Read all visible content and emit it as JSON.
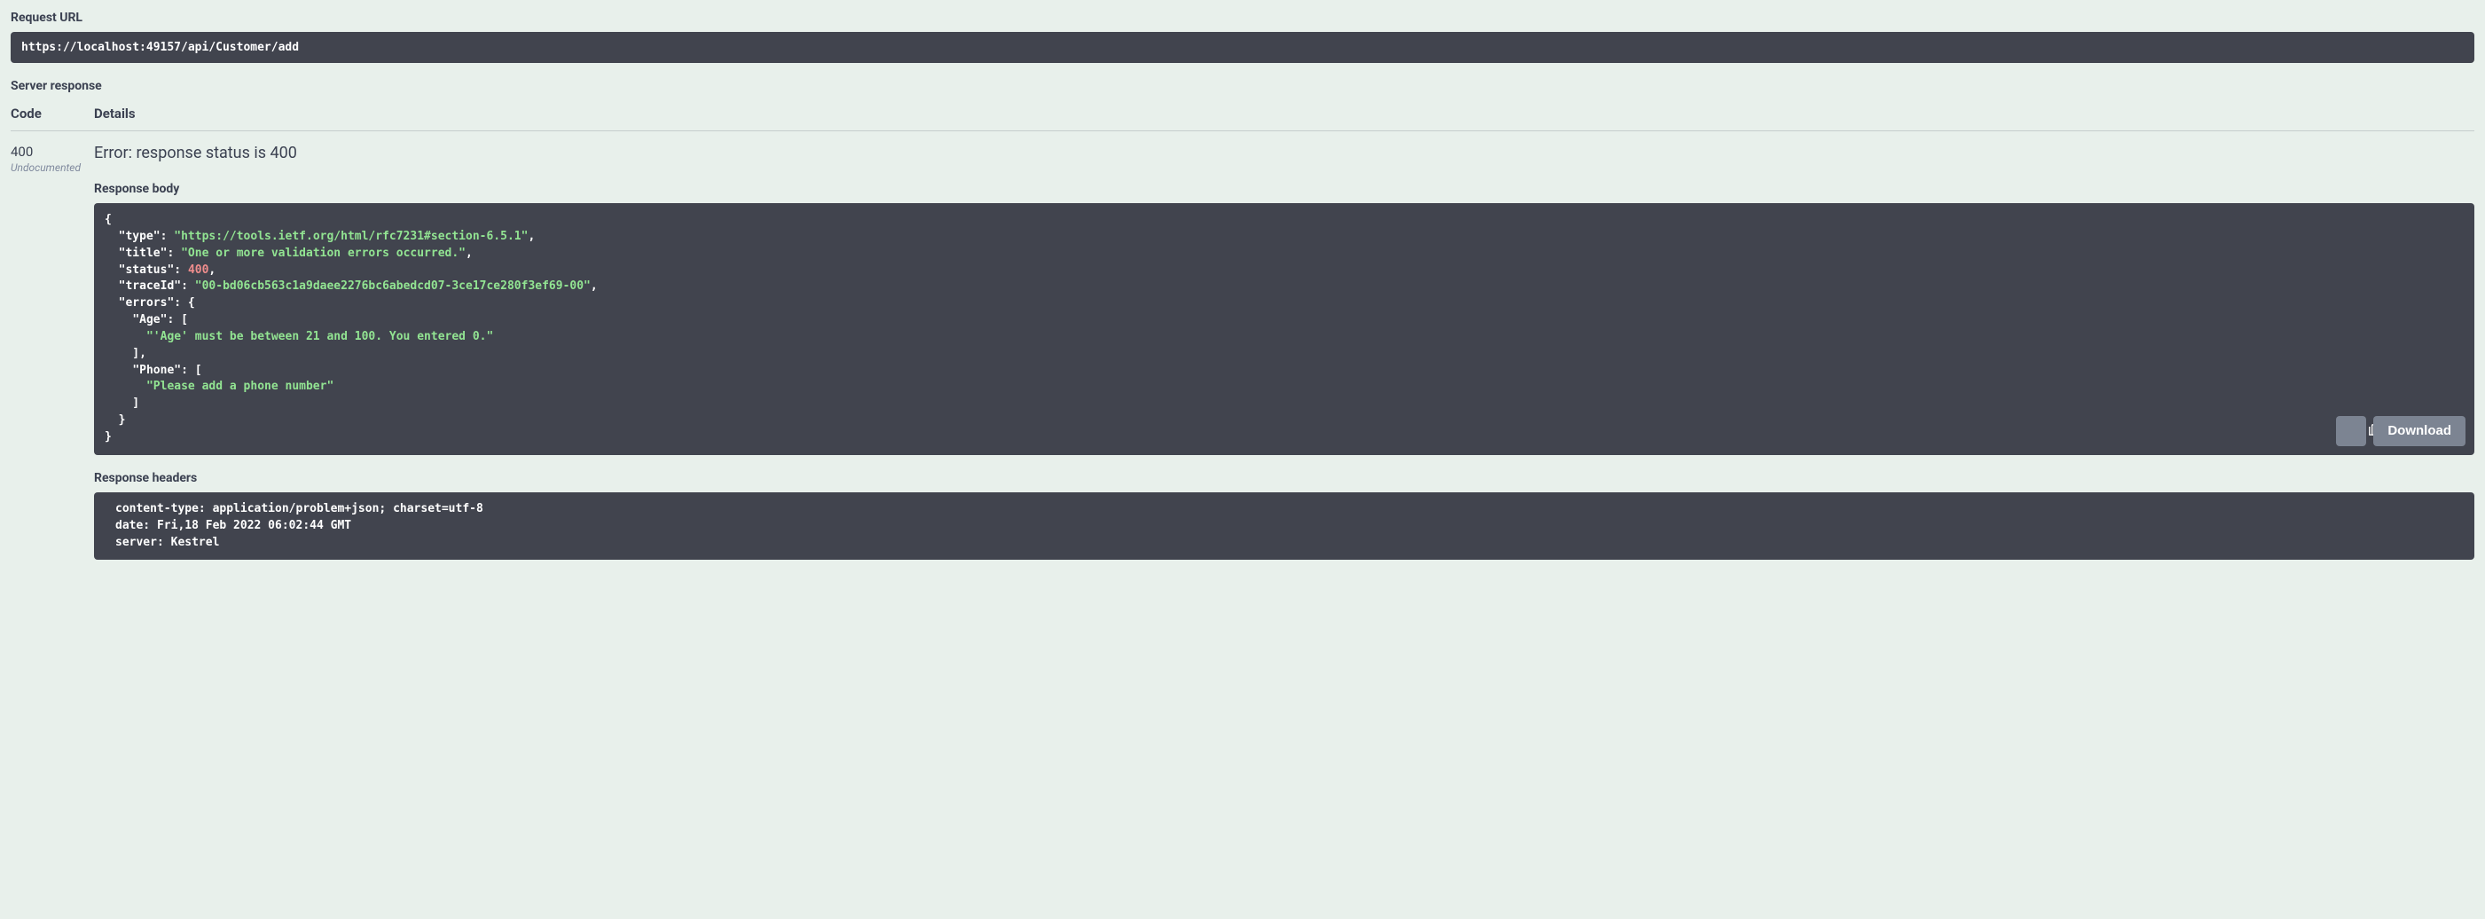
{
  "request_url_label": "Request URL",
  "request_url": "https://localhost:49157/api/Customer/add",
  "server_response_label": "Server response",
  "columns": {
    "code": "Code",
    "details": "Details"
  },
  "response": {
    "code": "400",
    "undocumented": "Undocumented",
    "error_line": "Error: response status is 400",
    "body_label": "Response body",
    "body_json": {
      "type": "https://tools.ietf.org/html/rfc7231#section-6.5.1",
      "title": "One or more validation errors occurred.",
      "status": 400,
      "traceId": "00-bd06cb563c1a9daee2276bc6abedcd07-3ce17ce280f3ef69-00",
      "errors": {
        "Age": [
          "'Age' must be between 21 and 100. You entered 0."
        ],
        "Phone": [
          "Please add a phone number"
        ]
      }
    },
    "download_label": "Download",
    "headers_label": "Response headers",
    "headers_text": "content-type: application/problem+json; charset=utf-8 \ndate: Fri,18 Feb 2022 06:02:44 GMT \nserver: Kestrel "
  }
}
